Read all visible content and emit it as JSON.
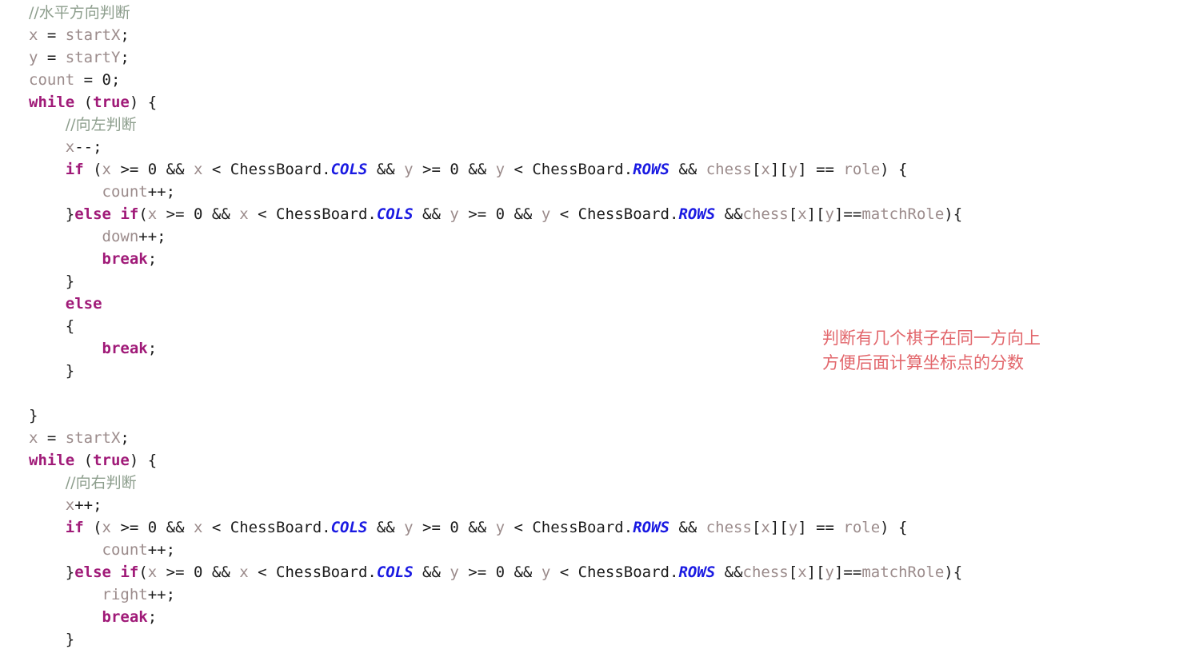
{
  "colors": {
    "background": "#ffffff",
    "comment": "#8d9e8d",
    "keyword": "#a01a78",
    "identifier": "#9b8b8b",
    "plain": "#1c1c1c",
    "static_field": "#1a1ae2",
    "annotation_red": "#e2666b"
  },
  "code": {
    "language": "java",
    "lines": [
      {
        "indent": 0,
        "tokens": [
          {
            "t": "//水平方向判断",
            "c": "comment"
          }
        ]
      },
      {
        "indent": 0,
        "tokens": [
          {
            "t": "x",
            "c": "ident"
          },
          {
            "t": " = ",
            "c": "plain"
          },
          {
            "t": "startX",
            "c": "ident"
          },
          {
            "t": ";",
            "c": "plain"
          }
        ]
      },
      {
        "indent": 0,
        "tokens": [
          {
            "t": "y",
            "c": "ident"
          },
          {
            "t": " = ",
            "c": "plain"
          },
          {
            "t": "startY",
            "c": "ident"
          },
          {
            "t": ";",
            "c": "plain"
          }
        ]
      },
      {
        "indent": 0,
        "tokens": [
          {
            "t": "count",
            "c": "ident"
          },
          {
            "t": " = ",
            "c": "plain"
          },
          {
            "t": "0",
            "c": "plain"
          },
          {
            "t": ";",
            "c": "plain"
          }
        ]
      },
      {
        "indent": 0,
        "tokens": [
          {
            "t": "while",
            "c": "keyword"
          },
          {
            "t": " (",
            "c": "plain"
          },
          {
            "t": "true",
            "c": "keyword"
          },
          {
            "t": ") {",
            "c": "plain"
          }
        ]
      },
      {
        "indent": 1,
        "tokens": [
          {
            "t": "//向左判断",
            "c": "comment"
          }
        ]
      },
      {
        "indent": 1,
        "tokens": [
          {
            "t": "x",
            "c": "ident"
          },
          {
            "t": "--;",
            "c": "plain"
          }
        ]
      },
      {
        "indent": 1,
        "tokens": [
          {
            "t": "if",
            "c": "keyword"
          },
          {
            "t": " (",
            "c": "plain"
          },
          {
            "t": "x",
            "c": "ident"
          },
          {
            "t": " >= ",
            "c": "plain"
          },
          {
            "t": "0",
            "c": "plain"
          },
          {
            "t": " && ",
            "c": "plain"
          },
          {
            "t": "x",
            "c": "ident"
          },
          {
            "t": " < ",
            "c": "plain"
          },
          {
            "t": "ChessBoard",
            "c": "plain"
          },
          {
            "t": ".",
            "c": "plain"
          },
          {
            "t": "COLS",
            "c": "static"
          },
          {
            "t": " && ",
            "c": "plain"
          },
          {
            "t": "y",
            "c": "ident"
          },
          {
            "t": " >= ",
            "c": "plain"
          },
          {
            "t": "0",
            "c": "plain"
          },
          {
            "t": " && ",
            "c": "plain"
          },
          {
            "t": "y",
            "c": "ident"
          },
          {
            "t": " < ",
            "c": "plain"
          },
          {
            "t": "ChessBoard",
            "c": "plain"
          },
          {
            "t": ".",
            "c": "plain"
          },
          {
            "t": "ROWS",
            "c": "static"
          },
          {
            "t": " && ",
            "c": "plain"
          },
          {
            "t": "chess",
            "c": "ident"
          },
          {
            "t": "[",
            "c": "plain"
          },
          {
            "t": "x",
            "c": "ident"
          },
          {
            "t": "][",
            "c": "plain"
          },
          {
            "t": "y",
            "c": "ident"
          },
          {
            "t": "] == ",
            "c": "plain"
          },
          {
            "t": "role",
            "c": "ident"
          },
          {
            "t": ") {",
            "c": "plain"
          }
        ]
      },
      {
        "indent": 2,
        "tokens": [
          {
            "t": "count",
            "c": "ident"
          },
          {
            "t": "++;",
            "c": "plain"
          }
        ]
      },
      {
        "indent": 1,
        "tokens": [
          {
            "t": "}",
            "c": "plain"
          },
          {
            "t": "else",
            "c": "keyword"
          },
          {
            "t": " ",
            "c": "plain"
          },
          {
            "t": "if",
            "c": "keyword"
          },
          {
            "t": "(",
            "c": "plain"
          },
          {
            "t": "x",
            "c": "ident"
          },
          {
            "t": " >= ",
            "c": "plain"
          },
          {
            "t": "0",
            "c": "plain"
          },
          {
            "t": " && ",
            "c": "plain"
          },
          {
            "t": "x",
            "c": "ident"
          },
          {
            "t": " < ",
            "c": "plain"
          },
          {
            "t": "ChessBoard",
            "c": "plain"
          },
          {
            "t": ".",
            "c": "plain"
          },
          {
            "t": "COLS",
            "c": "static"
          },
          {
            "t": " && ",
            "c": "plain"
          },
          {
            "t": "y",
            "c": "ident"
          },
          {
            "t": " >= ",
            "c": "plain"
          },
          {
            "t": "0",
            "c": "plain"
          },
          {
            "t": " && ",
            "c": "plain"
          },
          {
            "t": "y",
            "c": "ident"
          },
          {
            "t": " < ",
            "c": "plain"
          },
          {
            "t": "ChessBoard",
            "c": "plain"
          },
          {
            "t": ".",
            "c": "plain"
          },
          {
            "t": "ROWS",
            "c": "static"
          },
          {
            "t": " &&",
            "c": "plain"
          },
          {
            "t": "chess",
            "c": "ident"
          },
          {
            "t": "[",
            "c": "plain"
          },
          {
            "t": "x",
            "c": "ident"
          },
          {
            "t": "][",
            "c": "plain"
          },
          {
            "t": "y",
            "c": "ident"
          },
          {
            "t": "]==",
            "c": "plain"
          },
          {
            "t": "matchRole",
            "c": "ident"
          },
          {
            "t": "){",
            "c": "plain"
          }
        ]
      },
      {
        "indent": 2,
        "tokens": [
          {
            "t": "down",
            "c": "ident"
          },
          {
            "t": "++;",
            "c": "plain"
          }
        ]
      },
      {
        "indent": 2,
        "tokens": [
          {
            "t": "break",
            "c": "keyword"
          },
          {
            "t": ";",
            "c": "plain"
          }
        ]
      },
      {
        "indent": 1,
        "tokens": [
          {
            "t": "}",
            "c": "plain"
          }
        ]
      },
      {
        "indent": 1,
        "tokens": [
          {
            "t": "else",
            "c": "keyword"
          }
        ]
      },
      {
        "indent": 1,
        "tokens": [
          {
            "t": "{",
            "c": "plain"
          }
        ]
      },
      {
        "indent": 2,
        "tokens": [
          {
            "t": "break",
            "c": "keyword"
          },
          {
            "t": ";",
            "c": "plain"
          }
        ]
      },
      {
        "indent": 1,
        "tokens": [
          {
            "t": "}",
            "c": "plain"
          }
        ]
      },
      {
        "indent": 0,
        "tokens": []
      },
      {
        "indent": 0,
        "tokens": [
          {
            "t": "}",
            "c": "plain"
          }
        ]
      },
      {
        "indent": 0,
        "tokens": [
          {
            "t": "x",
            "c": "ident"
          },
          {
            "t": " = ",
            "c": "plain"
          },
          {
            "t": "startX",
            "c": "ident"
          },
          {
            "t": ";",
            "c": "plain"
          }
        ]
      },
      {
        "indent": 0,
        "tokens": [
          {
            "t": "while",
            "c": "keyword"
          },
          {
            "t": " (",
            "c": "plain"
          },
          {
            "t": "true",
            "c": "keyword"
          },
          {
            "t": ") {",
            "c": "plain"
          }
        ]
      },
      {
        "indent": 1,
        "tokens": [
          {
            "t": "//向右判断",
            "c": "comment"
          }
        ]
      },
      {
        "indent": 1,
        "tokens": [
          {
            "t": "x",
            "c": "ident"
          },
          {
            "t": "++;",
            "c": "plain"
          }
        ]
      },
      {
        "indent": 1,
        "tokens": [
          {
            "t": "if",
            "c": "keyword"
          },
          {
            "t": " (",
            "c": "plain"
          },
          {
            "t": "x",
            "c": "ident"
          },
          {
            "t": " >= ",
            "c": "plain"
          },
          {
            "t": "0",
            "c": "plain"
          },
          {
            "t": " && ",
            "c": "plain"
          },
          {
            "t": "x",
            "c": "ident"
          },
          {
            "t": " < ",
            "c": "plain"
          },
          {
            "t": "ChessBoard",
            "c": "plain"
          },
          {
            "t": ".",
            "c": "plain"
          },
          {
            "t": "COLS",
            "c": "static"
          },
          {
            "t": " && ",
            "c": "plain"
          },
          {
            "t": "y",
            "c": "ident"
          },
          {
            "t": " >= ",
            "c": "plain"
          },
          {
            "t": "0",
            "c": "plain"
          },
          {
            "t": " && ",
            "c": "plain"
          },
          {
            "t": "y",
            "c": "ident"
          },
          {
            "t": " < ",
            "c": "plain"
          },
          {
            "t": "ChessBoard",
            "c": "plain"
          },
          {
            "t": ".",
            "c": "plain"
          },
          {
            "t": "ROWS",
            "c": "static"
          },
          {
            "t": " && ",
            "c": "plain"
          },
          {
            "t": "chess",
            "c": "ident"
          },
          {
            "t": "[",
            "c": "plain"
          },
          {
            "t": "x",
            "c": "ident"
          },
          {
            "t": "][",
            "c": "plain"
          },
          {
            "t": "y",
            "c": "ident"
          },
          {
            "t": "] == ",
            "c": "plain"
          },
          {
            "t": "role",
            "c": "ident"
          },
          {
            "t": ") {",
            "c": "plain"
          }
        ]
      },
      {
        "indent": 2,
        "tokens": [
          {
            "t": "count",
            "c": "ident"
          },
          {
            "t": "++;",
            "c": "plain"
          }
        ]
      },
      {
        "indent": 1,
        "tokens": [
          {
            "t": "}",
            "c": "plain"
          },
          {
            "t": "else",
            "c": "keyword"
          },
          {
            "t": " ",
            "c": "plain"
          },
          {
            "t": "if",
            "c": "keyword"
          },
          {
            "t": "(",
            "c": "plain"
          },
          {
            "t": "x",
            "c": "ident"
          },
          {
            "t": " >= ",
            "c": "plain"
          },
          {
            "t": "0",
            "c": "plain"
          },
          {
            "t": " && ",
            "c": "plain"
          },
          {
            "t": "x",
            "c": "ident"
          },
          {
            "t": " < ",
            "c": "plain"
          },
          {
            "t": "ChessBoard",
            "c": "plain"
          },
          {
            "t": ".",
            "c": "plain"
          },
          {
            "t": "COLS",
            "c": "static"
          },
          {
            "t": " && ",
            "c": "plain"
          },
          {
            "t": "y",
            "c": "ident"
          },
          {
            "t": " >= ",
            "c": "plain"
          },
          {
            "t": "0",
            "c": "plain"
          },
          {
            "t": " && ",
            "c": "plain"
          },
          {
            "t": "y",
            "c": "ident"
          },
          {
            "t": " < ",
            "c": "plain"
          },
          {
            "t": "ChessBoard",
            "c": "plain"
          },
          {
            "t": ".",
            "c": "plain"
          },
          {
            "t": "ROWS",
            "c": "static"
          },
          {
            "t": " &&",
            "c": "plain"
          },
          {
            "t": "chess",
            "c": "ident"
          },
          {
            "t": "[",
            "c": "plain"
          },
          {
            "t": "x",
            "c": "ident"
          },
          {
            "t": "][",
            "c": "plain"
          },
          {
            "t": "y",
            "c": "ident"
          },
          {
            "t": "]==",
            "c": "plain"
          },
          {
            "t": "matchRole",
            "c": "ident"
          },
          {
            "t": "){",
            "c": "plain"
          }
        ]
      },
      {
        "indent": 2,
        "tokens": [
          {
            "t": "right",
            "c": "ident"
          },
          {
            "t": "++;",
            "c": "plain"
          }
        ]
      },
      {
        "indent": 2,
        "tokens": [
          {
            "t": "break",
            "c": "keyword"
          },
          {
            "t": ";",
            "c": "plain"
          }
        ]
      },
      {
        "indent": 1,
        "tokens": [
          {
            "t": "}",
            "c": "plain"
          }
        ]
      }
    ]
  },
  "annotation": {
    "lines": [
      "判断有几个棋子在同一方向上",
      "方便后面计算坐标点的分数"
    ]
  }
}
